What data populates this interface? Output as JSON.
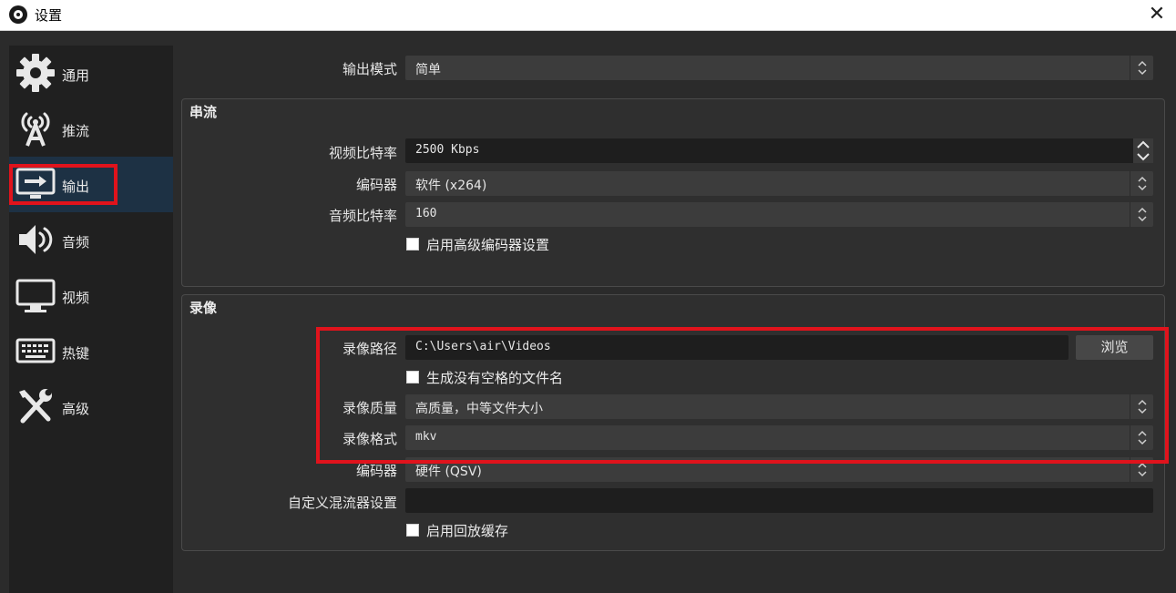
{
  "window": {
    "title": "设置",
    "app_icon": "obs-logo-icon",
    "close_glyph": "✕"
  },
  "sidebar": {
    "items": [
      {
        "label": "通用",
        "icon": "gear-icon"
      },
      {
        "label": "推流",
        "icon": "broadcast-antenna-icon"
      },
      {
        "label": "输出",
        "icon": "output-monitor-icon",
        "active": true
      },
      {
        "label": "音频",
        "icon": "speaker-icon"
      },
      {
        "label": "视频",
        "icon": "monitor-icon"
      },
      {
        "label": "热键",
        "icon": "keyboard-icon"
      },
      {
        "label": "高级",
        "icon": "tools-icon"
      }
    ]
  },
  "output_mode": {
    "label": "输出模式",
    "value": "简单"
  },
  "streaming": {
    "title": "串流",
    "video_bitrate": {
      "label": "视频比特率",
      "value": "2500 Kbps"
    },
    "encoder": {
      "label": "编码器",
      "value": "软件 (x264)"
    },
    "audio_bitrate": {
      "label": "音频比特率",
      "value": "160"
    },
    "advanced_checkbox": {
      "label": "启用高级编码器设置",
      "checked": false
    }
  },
  "recording": {
    "title": "录像",
    "path": {
      "label": "录像路径",
      "value": "C:\\Users\\air\\Videos",
      "browse_label": "浏览"
    },
    "no_space_checkbox": {
      "label": "生成没有空格的文件名",
      "checked": false
    },
    "quality": {
      "label": "录像质量",
      "value": "高质量，中等文件大小"
    },
    "format": {
      "label": "录像格式",
      "value": "mkv"
    },
    "encoder": {
      "label": "编码器",
      "value": "硬件 (QSV)"
    },
    "muxer": {
      "label": "自定义混流器设置",
      "value": ""
    },
    "replay_checkbox": {
      "label": "启用回放缓存",
      "checked": false
    }
  },
  "colors": {
    "highlight": "#e0131c",
    "active_nav": "#1d3144",
    "background": "#2b2b2b",
    "sidebar": "#202020"
  }
}
